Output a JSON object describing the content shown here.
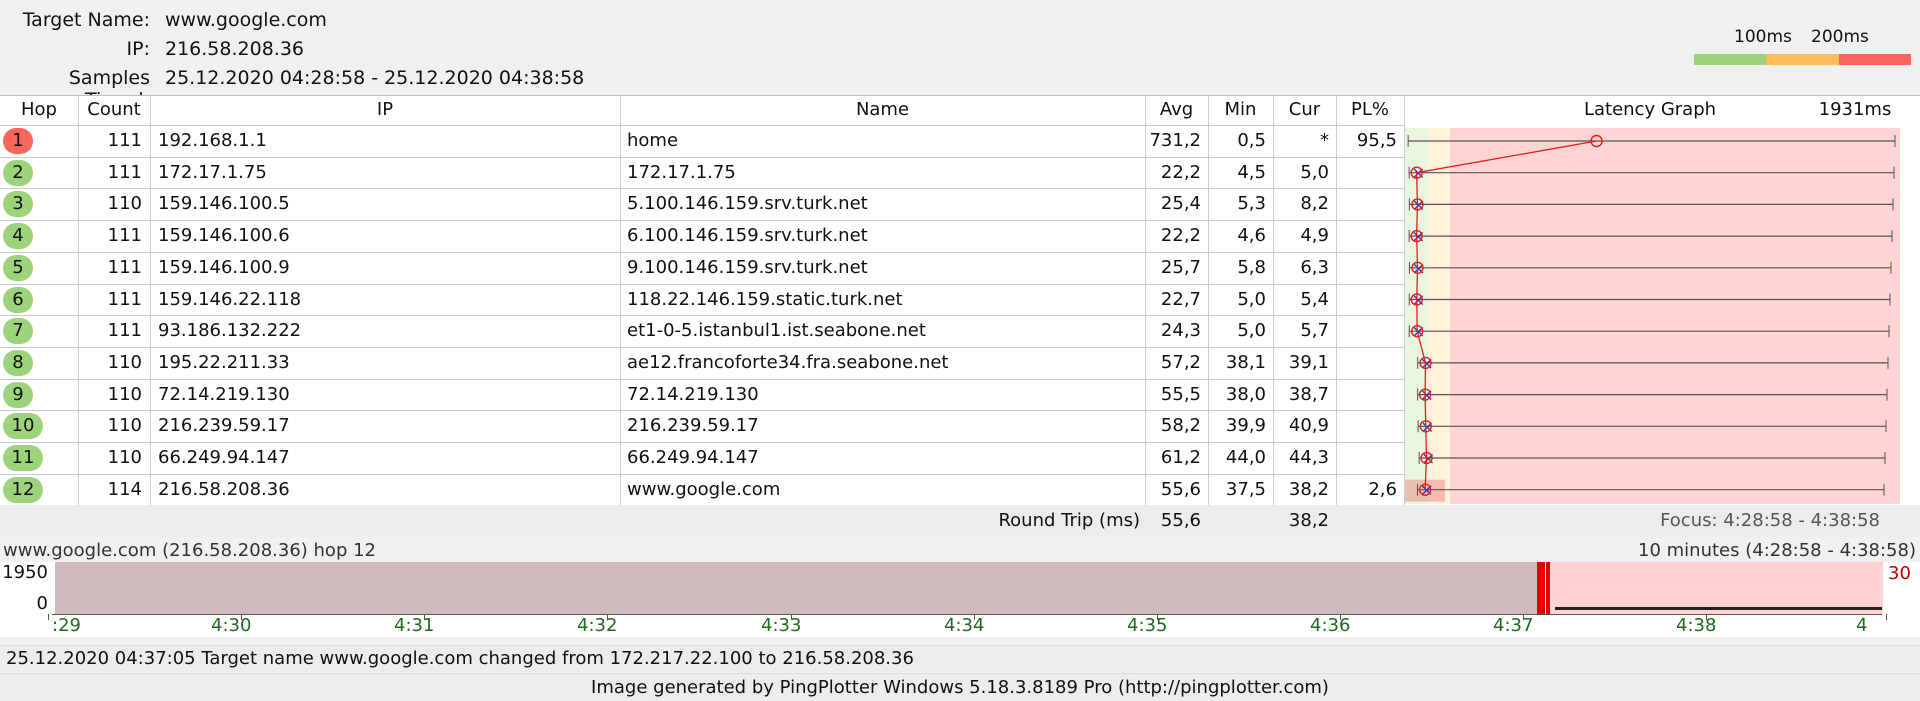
{
  "header": {
    "target_label": "Target Name:",
    "target_value": "www.google.com",
    "ip_label": "IP:",
    "ip_value": "216.58.208.36",
    "samples_label": "Samples Timed:",
    "samples_value": "25.12.2020 04:28:58 - 25.12.2020 04:38:58"
  },
  "legend": {
    "t1": "100ms",
    "t2": "200ms",
    "colors": [
      "#9dd47b",
      "#fbbc5b",
      "#f8665a"
    ]
  },
  "columns": {
    "hop": "Hop",
    "count": "Count",
    "ip": "IP",
    "name": "Name",
    "avg": "Avg",
    "min": "Min",
    "cur": "Cur",
    "pl": "PL%",
    "graph": "Latency Graph",
    "max": "1931ms"
  },
  "rows": [
    {
      "hop": "1",
      "count": "111",
      "ip": "192.168.1.1",
      "name": "home",
      "avg": "731,2",
      "min": "0,5",
      "cur": "*",
      "pl": "95,5",
      "status": "red"
    },
    {
      "hop": "2",
      "count": "111",
      "ip": "172.17.1.75",
      "name": "172.17.1.75",
      "avg": "22,2",
      "min": "4,5",
      "cur": "5,0",
      "pl": "",
      "status": "green"
    },
    {
      "hop": "3",
      "count": "110",
      "ip": "159.146.100.5",
      "name": "5.100.146.159.srv.turk.net",
      "avg": "25,4",
      "min": "5,3",
      "cur": "8,2",
      "pl": "",
      "status": "green"
    },
    {
      "hop": "4",
      "count": "111",
      "ip": "159.146.100.6",
      "name": "6.100.146.159.srv.turk.net",
      "avg": "22,2",
      "min": "4,6",
      "cur": "4,9",
      "pl": "",
      "status": "green"
    },
    {
      "hop": "5",
      "count": "111",
      "ip": "159.146.100.9",
      "name": "9.100.146.159.srv.turk.net",
      "avg": "25,7",
      "min": "5,8",
      "cur": "6,3",
      "pl": "",
      "status": "green"
    },
    {
      "hop": "6",
      "count": "111",
      "ip": "159.146.22.118",
      "name": "118.22.146.159.static.turk.net",
      "avg": "22,7",
      "min": "5,0",
      "cur": "5,4",
      "pl": "",
      "status": "green"
    },
    {
      "hop": "7",
      "count": "111",
      "ip": "93.186.132.222",
      "name": "et1-0-5.istanbul1.ist.seabone.net",
      "avg": "24,3",
      "min": "5,0",
      "cur": "5,7",
      "pl": "",
      "status": "green"
    },
    {
      "hop": "8",
      "count": "110",
      "ip": "195.22.211.33",
      "name": "ae12.francoforte34.fra.seabone.net",
      "avg": "57,2",
      "min": "38,1",
      "cur": "39,1",
      "pl": "",
      "status": "green"
    },
    {
      "hop": "9",
      "count": "110",
      "ip": "72.14.219.130",
      "name": "72.14.219.130",
      "avg": "55,5",
      "min": "38,0",
      "cur": "38,7",
      "pl": "",
      "status": "green"
    },
    {
      "hop": "10",
      "count": "110",
      "ip": "216.239.59.17",
      "name": "216.239.59.17",
      "avg": "58,2",
      "min": "39,9",
      "cur": "40,9",
      "pl": "",
      "status": "green"
    },
    {
      "hop": "11",
      "count": "110",
      "ip": "66.249.94.147",
      "name": "66.249.94.147",
      "avg": "61,2",
      "min": "44,0",
      "cur": "44,3",
      "pl": "",
      "status": "green"
    },
    {
      "hop": "12",
      "count": "114",
      "ip": "216.58.208.36",
      "name": "www.google.com",
      "avg": "55,6",
      "min": "37,5",
      "cur": "38,2",
      "pl": "2,6",
      "status": "green"
    }
  ],
  "roundtrip": {
    "label": "Round Trip (ms)",
    "avg": "55,6",
    "cur": "38,2",
    "focus": "Focus: 4:28:58 - 4:38:58"
  },
  "timeline": {
    "caption_left": "www.google.com (216.58.208.36) hop 12",
    "caption_right": "10 minutes (4:28:58 - 4:38:58)",
    "y_top": "1950",
    "y_bottom": "0",
    "right_value": "30",
    "ticks": [
      ":29",
      "4:30",
      "4:31",
      "4:32",
      "4:33",
      "4:34",
      "4:35",
      "4:36",
      "4:37",
      "4:38",
      "4"
    ]
  },
  "event": "25.12.2020 04:37:05 Target name www.google.com changed from 172.217.22.100 to 216.58.208.36",
  "credit": "Image generated by PingPlotter Windows 5.18.3.8189 Pro (http://pingplotter.com)"
}
